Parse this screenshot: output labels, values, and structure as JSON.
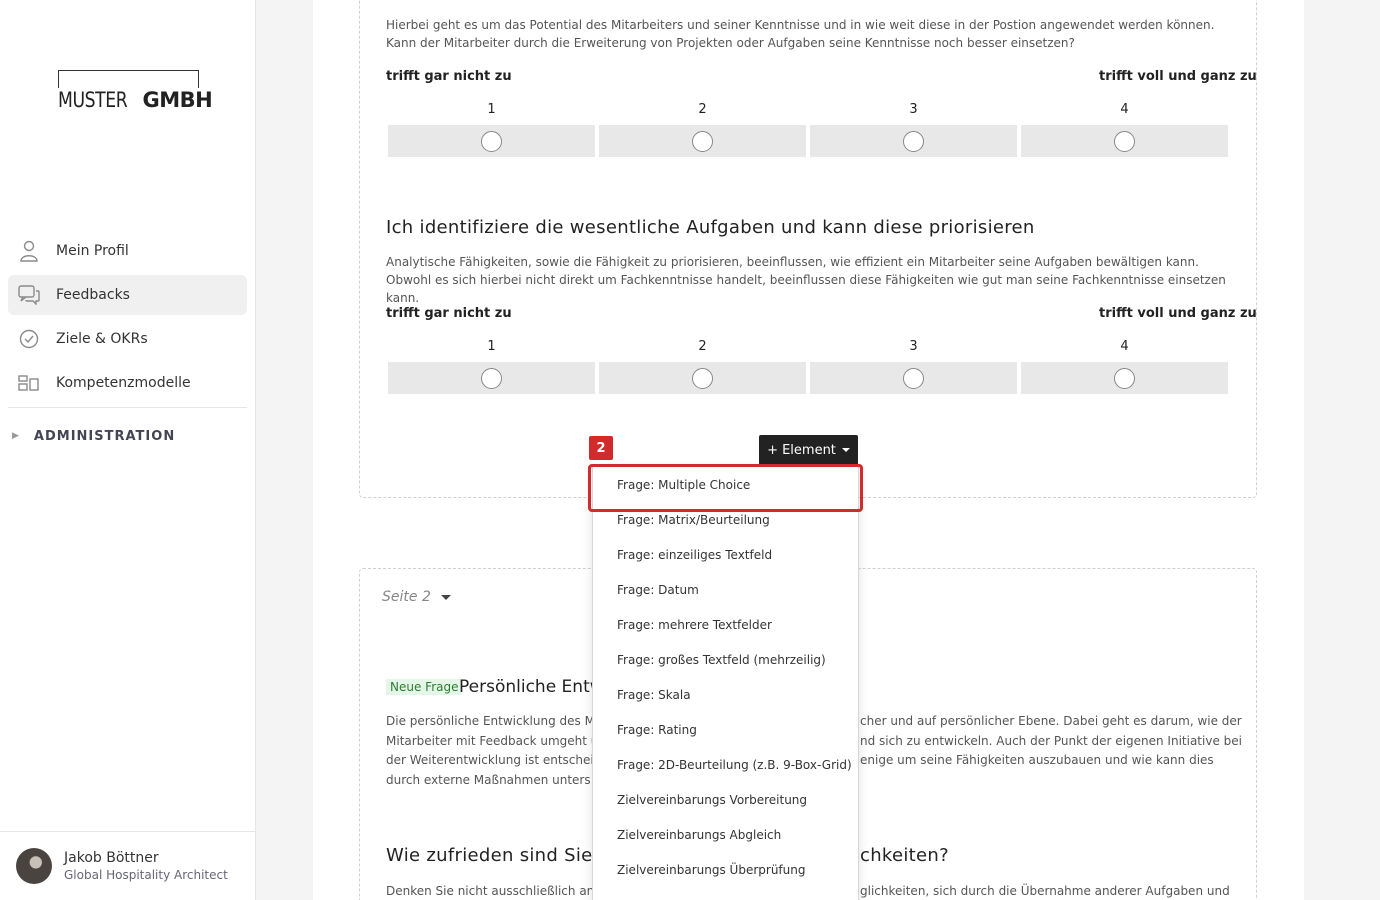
{
  "sidebar": {
    "logo": {
      "thin": "MUSTER",
      "bold": "GMBH"
    },
    "items": [
      {
        "label": "Mein Profil",
        "icon": "person-icon"
      },
      {
        "label": "Feedbacks",
        "icon": "chat-icon"
      },
      {
        "label": "Ziele & OKRs",
        "icon": "check-circle-icon"
      },
      {
        "label": "Kompetenzmodelle",
        "icon": "blocks-icon"
      }
    ],
    "admin_label": "ADMINISTRATION",
    "user": {
      "name": "Jakob Böttner",
      "role": "Global Hospitality Architect"
    }
  },
  "questions": [
    {
      "description": "Hierbei geht es um das Potential des Mitarbeiters und seiner Kenntnisse und in wie weit diese in der Postion angewendet werden können. Kann der Mitarbeiter durch die Erweiterung von Projekten oder Aufgaben seine Kenntnisse noch besser einsetzen?",
      "low_label": "trifft gar nicht zu",
      "high_label": "trifft voll und ganz zu",
      "scale": [
        "1",
        "2",
        "3",
        "4"
      ]
    },
    {
      "title": "Ich identifiziere die wesentliche Aufgaben und kann diese priorisieren",
      "description": "Analytische Fähigkeiten, sowie die Fähigkeit zu priorisieren, beeinflussen, wie effizient ein Mitarbeiter seine Aufgaben bewältigen kann. Obwohl es sich hierbei nicht direkt um Fachkenntnisse handelt, beeinflussen diese Fähigkeiten wie gut man seine Fachkenntnisse einsetzen kann.",
      "low_label": "trifft gar nicht zu",
      "high_label": "trifft voll und ganz zu",
      "scale": [
        "1",
        "2",
        "3",
        "4"
      ]
    }
  ],
  "element_button": "+ Element",
  "step_badge": "2",
  "dropdown": [
    "Frage: Multiple Choice",
    "Frage: Matrix/Beurteilung",
    "Frage: einzeiliges Textfeld",
    "Frage: Datum",
    "Frage: mehrere Textfelder",
    "Frage: großes Textfeld (mehrzeilig)",
    "Frage: Skala",
    "Frage: Rating",
    "Frage: 2D-Beurteilung (z.B. 9-Box-Grid)",
    "Zielvereinbarungs Vorbereitung",
    "Zielvereinbarungs Abgleich",
    "Zielvereinbarungs Überprüfung"
  ],
  "page2": {
    "label": "Seite 2",
    "new_tag": "Neue Frage",
    "title_visible": "Persönliche Entw",
    "desc_left": [
      "Die persönliche Entwicklung des Mi",
      "Mitarbeiter mit Feedback umgeht u",
      "der Weiterentwicklung ist entschei",
      "durch externe Maßnahmen unters"
    ],
    "desc_right": [
      "cher und auf persönlicher Ebene. Dabei geht es darum, wie der",
      "nd sich zu entwickeln. Auch der Punkt der eigenen Initiative bei",
      "enige um seine Fähigkeiten auszubauen und wie kann dies",
      ""
    ],
    "q2_title_left": "Wie zufrieden sind Sie",
    "q2_title_right": "chkeiten?",
    "q2_desc_left": "Denken Sie nicht ausschließlich an Tr",
    "q2_desc_right": "glichkeiten, sich durch die Übernahme anderer Aufgaben und"
  }
}
